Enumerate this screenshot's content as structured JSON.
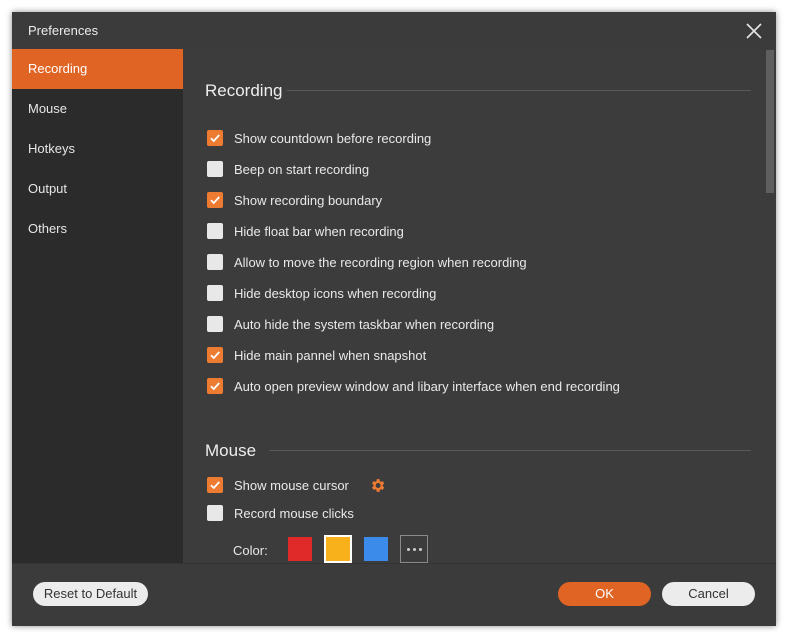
{
  "window": {
    "title": "Preferences"
  },
  "sidebar": {
    "items": [
      {
        "label": "Recording",
        "active": true
      },
      {
        "label": "Mouse",
        "active": false
      },
      {
        "label": "Hotkeys",
        "active": false
      },
      {
        "label": "Output",
        "active": false
      },
      {
        "label": "Others",
        "active": false
      }
    ]
  },
  "recording": {
    "heading": "Recording",
    "options": [
      {
        "label": "Show countdown before recording",
        "checked": true
      },
      {
        "label": "Beep on start recording",
        "checked": false
      },
      {
        "label": "Show recording boundary",
        "checked": true
      },
      {
        "label": "Hide float bar when recording",
        "checked": false
      },
      {
        "label": "Allow to move the recording region when recording",
        "checked": false
      },
      {
        "label": "Hide desktop icons when recording",
        "checked": false
      },
      {
        "label": "Auto hide the system taskbar when recording",
        "checked": false
      },
      {
        "label": "Hide main pannel when snapshot",
        "checked": true
      },
      {
        "label": "Auto open preview window and libary interface when end recording",
        "checked": true
      }
    ]
  },
  "mouse": {
    "heading": "Mouse",
    "show_cursor": {
      "label": "Show mouse cursor",
      "checked": true
    },
    "record_clicks": {
      "label": "Record mouse clicks",
      "checked": false
    },
    "color_label": "Color:",
    "colors": [
      "#e02a2a",
      "#f8b11b",
      "#3a8bea"
    ],
    "selected_color": "#f8b11b"
  },
  "footer": {
    "reset_label": "Reset to Default",
    "ok_label": "OK",
    "cancel_label": "Cancel"
  },
  "theme": {
    "accent": "#e06424",
    "checkbox_on": "#ee7b32"
  }
}
